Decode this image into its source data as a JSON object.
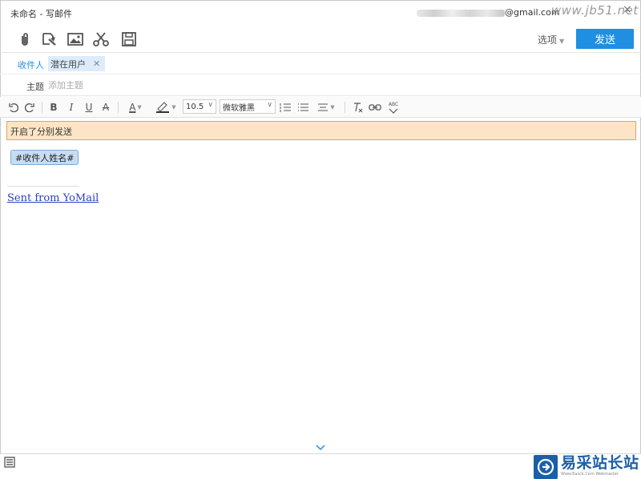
{
  "window": {
    "title": "未命名 - 写邮件",
    "account_suffix": "@gmail.com",
    "watermark": "www.jb51.net"
  },
  "toolbar": {
    "icons": [
      "attachment-icon",
      "screenshot-icon",
      "image-icon",
      "scissors-icon",
      "save-icon"
    ],
    "options_label": "选项",
    "send_label": "发送"
  },
  "recipients": {
    "label": "收件人",
    "tags": [
      "潜在用户"
    ]
  },
  "subject": {
    "label": "主题",
    "placeholder": "添加主题",
    "value": ""
  },
  "format": {
    "font_size": "10.5",
    "font_family": "微软雅黑",
    "bold": "B",
    "italic": "I",
    "underline": "U",
    "strike": "A",
    "font_color": "A",
    "spell": "ABC"
  },
  "notice": "开启了分别发送",
  "body": {
    "variable_chip": "#收件人姓名#",
    "signature_link": "Sent from YoMail"
  },
  "brand": {
    "name": "易采站长站",
    "sub": "Www.Easck.Com  Webmaster"
  },
  "colors": {
    "accent": "#1e8fe1",
    "notice_bg": "#fce5c6",
    "notice_border": "#d9a56b",
    "tag_bg": "#dcecfb"
  }
}
